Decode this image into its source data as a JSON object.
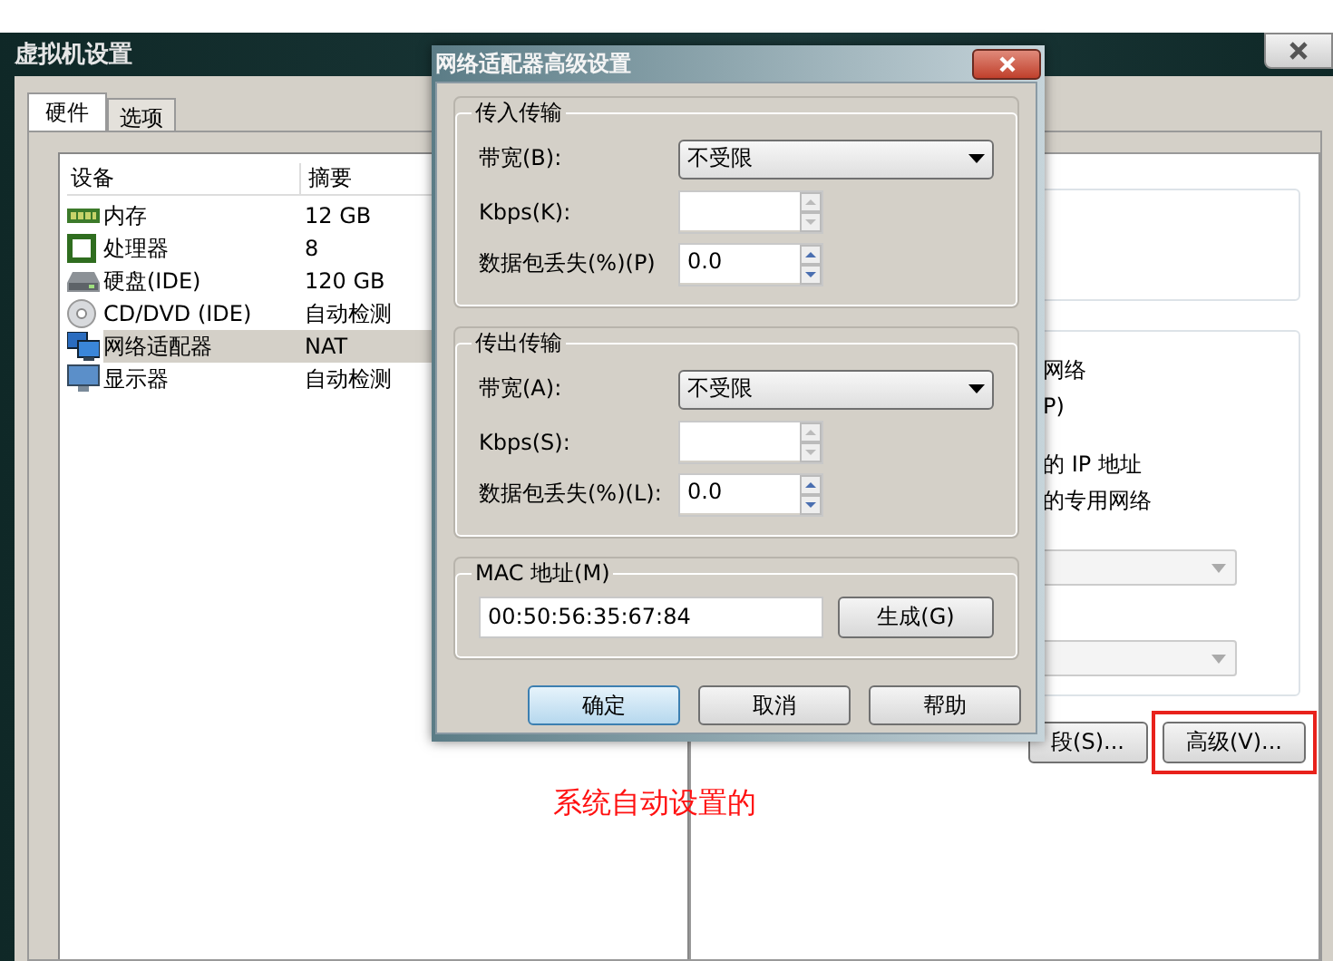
{
  "window": {
    "title": "虚拟机设置"
  },
  "tabs": [
    {
      "label": "硬件",
      "selected": true
    },
    {
      "label": "选项",
      "selected": false
    }
  ],
  "device_table": {
    "columns": [
      "设备",
      "摘要"
    ],
    "rows": [
      {
        "kind": "memory",
        "name": "内存",
        "summary": "12 GB",
        "selected": false
      },
      {
        "kind": "cpu",
        "name": "处理器",
        "summary": "8",
        "selected": false
      },
      {
        "kind": "disk",
        "name": "硬盘(IDE)",
        "summary": "120 GB",
        "selected": false
      },
      {
        "kind": "cd",
        "name": "CD/DVD (IDE)",
        "summary": "自动检测",
        "selected": false
      },
      {
        "kind": "network",
        "name": "网络适配器",
        "summary": "NAT",
        "selected": true
      },
      {
        "kind": "display",
        "name": "显示器",
        "summary": "自动检测",
        "selected": false
      }
    ]
  },
  "right_panel": {
    "texts": [
      "网络",
      "P)",
      "的 IP 地址",
      "的专用网络"
    ],
    "dropdowns": [
      {
        "disabled": true
      },
      {
        "disabled": true
      }
    ],
    "buttons": [
      {
        "label": "段(S)...",
        "highlighted": false
      },
      {
        "label": "高级(V)...",
        "highlighted": true
      }
    ]
  },
  "annotation": {
    "text": "系统自动设置的"
  },
  "dialog": {
    "title": "网络适配器高级设置",
    "groups": [
      {
        "title": "传入传输",
        "rows": [
          {
            "kind": "select",
            "label": "带宽(B):",
            "value": "不受限"
          },
          {
            "kind": "spin",
            "label": "Kbps(K):",
            "disabled": true
          },
          {
            "kind": "spin",
            "label": "数据包丢失(%)(P)",
            "value": "0.0",
            "disabled": false
          }
        ]
      },
      {
        "title": "传出传输",
        "rows": [
          {
            "kind": "select",
            "label": "带宽(A):",
            "value": "不受限"
          },
          {
            "kind": "spin",
            "label": "Kbps(S):",
            "disabled": true
          },
          {
            "kind": "spin",
            "label": "数据包丢失(%)(L):",
            "value": "0.0",
            "disabled": false
          }
        ]
      }
    ],
    "mac": {
      "title": "MAC 地址(M)",
      "value": "00:50:56:35:67:84",
      "button": "生成(G)"
    },
    "buttons": [
      {
        "label": "确定",
        "default": true
      },
      {
        "label": "取消",
        "default": false
      },
      {
        "label": "帮助",
        "default": false
      }
    ]
  }
}
